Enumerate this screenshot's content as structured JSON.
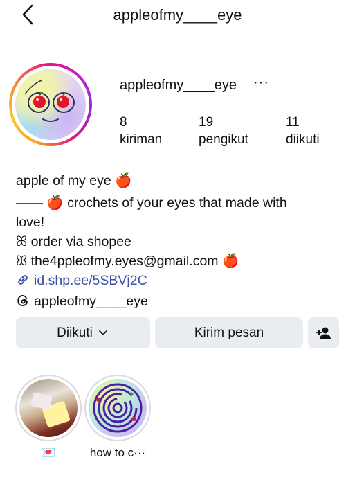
{
  "header": {
    "title": "appleofmy____eye"
  },
  "profile": {
    "username": "appleofmy____eye",
    "more": "···",
    "stats": [
      {
        "value": "8",
        "label": "kiriman"
      },
      {
        "value": "19",
        "label": "pengikut"
      },
      {
        "value": "11",
        "label": "diikuti"
      }
    ]
  },
  "bio": {
    "name": "apple of my eye 🍎",
    "line1": "—— 🍎 crochets of your eyes that made with",
    "line2": "love!",
    "line3": "ꕤ order via shopee",
    "line4": "ꕤ the4ppleofmy.eyes@gmail.com 🍎",
    "link": "id.shp.ee/5SBVj2C",
    "threads": "appleofmy____eye"
  },
  "actions": {
    "following_label": "Diikuti",
    "message_label": "Kirim pesan"
  },
  "highlights": [
    {
      "label": "💌"
    },
    {
      "label": "how to c···"
    }
  ],
  "colors": {
    "link": "#3b4fa6",
    "button_bg": "#e9ecf0",
    "ring_start": "#f7a21b",
    "ring_end": "#c21ec7"
  },
  "icons": [
    "back-arrow-icon",
    "more-icon",
    "link-icon",
    "threads-icon",
    "chevron-down-icon",
    "add-person-icon"
  ]
}
